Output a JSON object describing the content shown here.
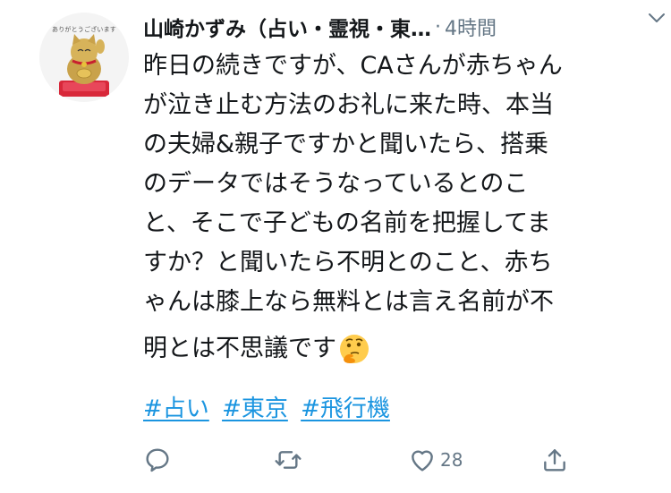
{
  "author": {
    "display_name": "山崎かずみ（占い・霊視・東…",
    "separator": "·",
    "timestamp": "4時間",
    "avatar_caption": "ありがとうございます"
  },
  "tweet": {
    "lines": [
      "昨日の続きですが、CAさんが赤ちゃん",
      "が泣き止む方法のお礼に来た時、本当",
      "の夫婦&親子ですかと聞いたら、搭乗",
      "のデータではそうなっているとのこ",
      "と、そこで子どもの名前を把握してま",
      "すか？と聞いたら不明とのこと、赤ち",
      "ゃんは膝上なら無料とは言え名前が不",
      "明とは不思議です"
    ],
    "emoji": "thinking-face",
    "hashtags": [
      "#占い",
      "#東京",
      "#飛行機"
    ]
  },
  "actions": {
    "reply_count": "",
    "retweet_count": "",
    "like_count": "28",
    "share_count": ""
  },
  "colors": {
    "text": "#14171a",
    "secondary": "#657786",
    "link": "#1b95e0"
  }
}
